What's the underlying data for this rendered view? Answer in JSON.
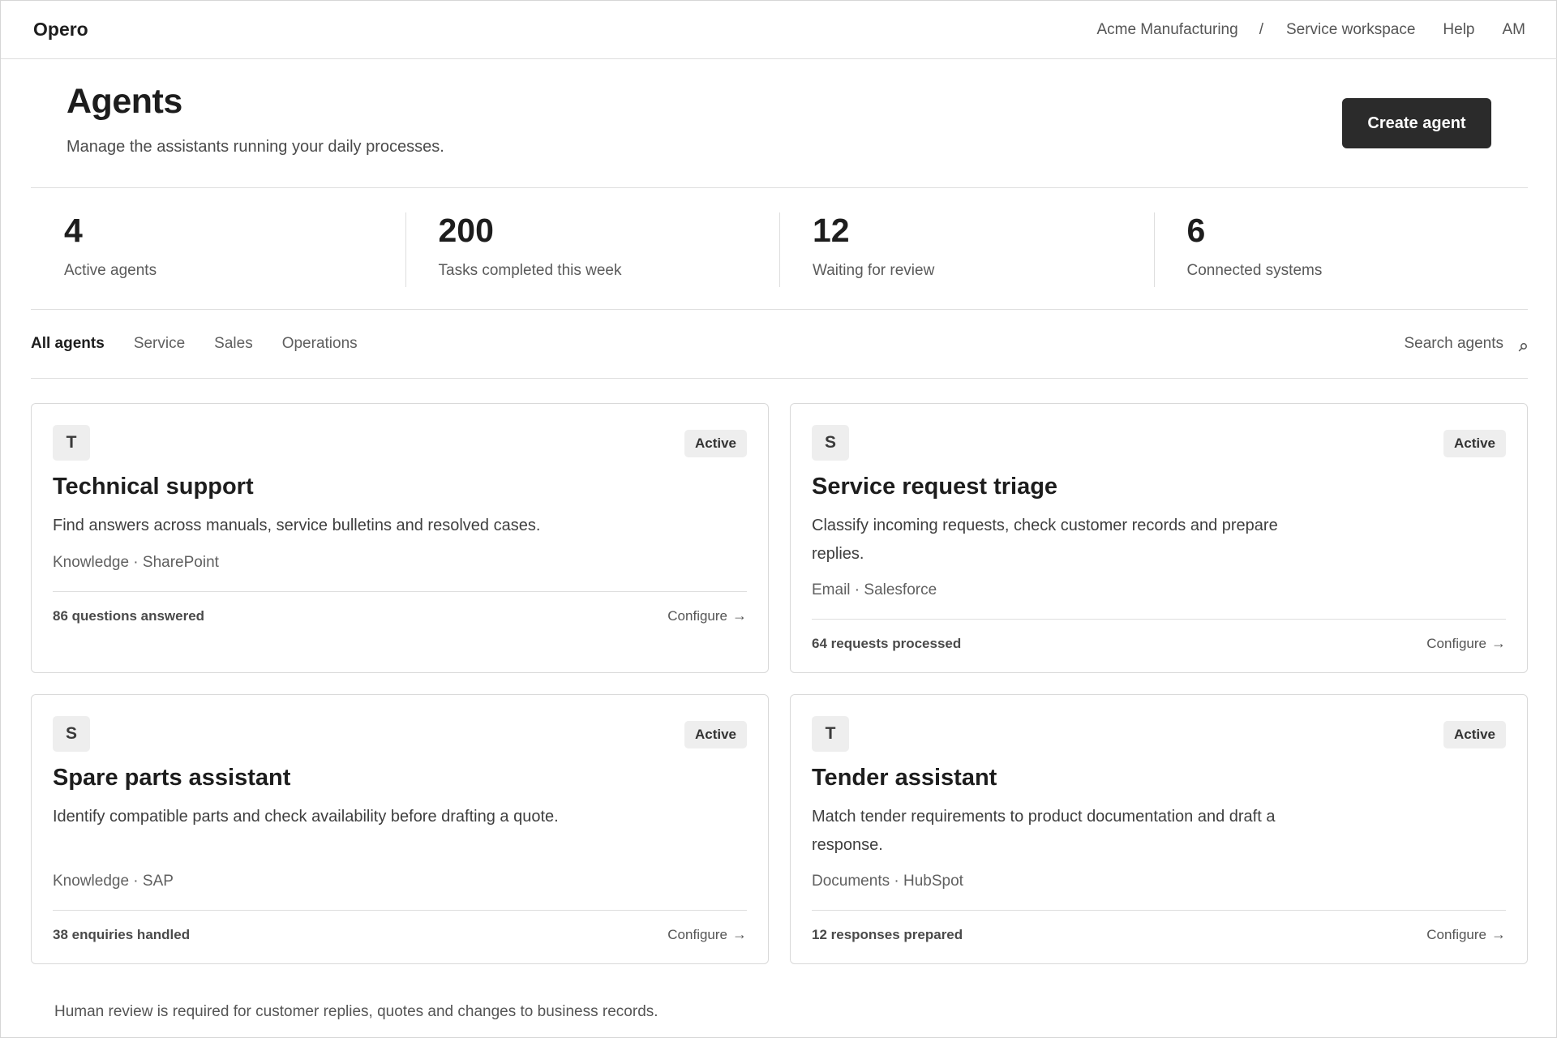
{
  "app": {
    "name": "Opero"
  },
  "topnav": {
    "organization": "Acme Manufacturing",
    "separator": "/",
    "workspace": "Service workspace",
    "help": "Help",
    "user_initials": "AM"
  },
  "header": {
    "title": "Agents",
    "subtitle": "Manage the assistants running your daily processes.",
    "create_button": "Create agent"
  },
  "stats": [
    {
      "value": "4",
      "label": "Active agents"
    },
    {
      "value": "200",
      "label": "Tasks completed this week"
    },
    {
      "value": "12",
      "label": "Waiting for review"
    },
    {
      "value": "6",
      "label": "Connected systems"
    }
  ],
  "tabs": [
    {
      "label": "All agents",
      "active": true
    },
    {
      "label": "Service",
      "active": false
    },
    {
      "label": "Sales",
      "active": false
    },
    {
      "label": "Operations",
      "active": false
    }
  ],
  "search": {
    "placeholder": "Search agents",
    "icon": "search-icon"
  },
  "agents": [
    {
      "initial": "T",
      "status": "Active",
      "name": "Technical support",
      "description": "Find answers across manuals, service bulletins and resolved cases.",
      "tags": "Knowledge · SharePoint",
      "metric": "86 questions answered",
      "action": "Configure",
      "action_icon": "→"
    },
    {
      "initial": "S",
      "status": "Active",
      "name": "Service request triage",
      "description": "Classify incoming requests, check customer records and prepare replies.",
      "tags": "Email · Salesforce",
      "metric": "64 requests processed",
      "action": "Configure",
      "action_icon": "→"
    },
    {
      "initial": "S",
      "status": "Active",
      "name": "Spare parts assistant",
      "description": "Identify compatible parts and check availability before drafting a quote.",
      "tags": "Knowledge · SAP",
      "metric": "38 enquiries handled",
      "action": "Configure",
      "action_icon": "→"
    },
    {
      "initial": "T",
      "status": "Active",
      "name": "Tender assistant",
      "description": "Match tender requirements to product documentation and draft a response.",
      "tags": "Documents · HubSpot",
      "metric": "12 responses prepared",
      "action": "Configure",
      "action_icon": "→"
    }
  ],
  "footer": {
    "note": "Human review is required for customer replies, quotes and changes to business records."
  },
  "colors": {
    "primary_button": "#2b2b2b",
    "badge_bg": "#eeeeee",
    "border": "#dedede"
  }
}
